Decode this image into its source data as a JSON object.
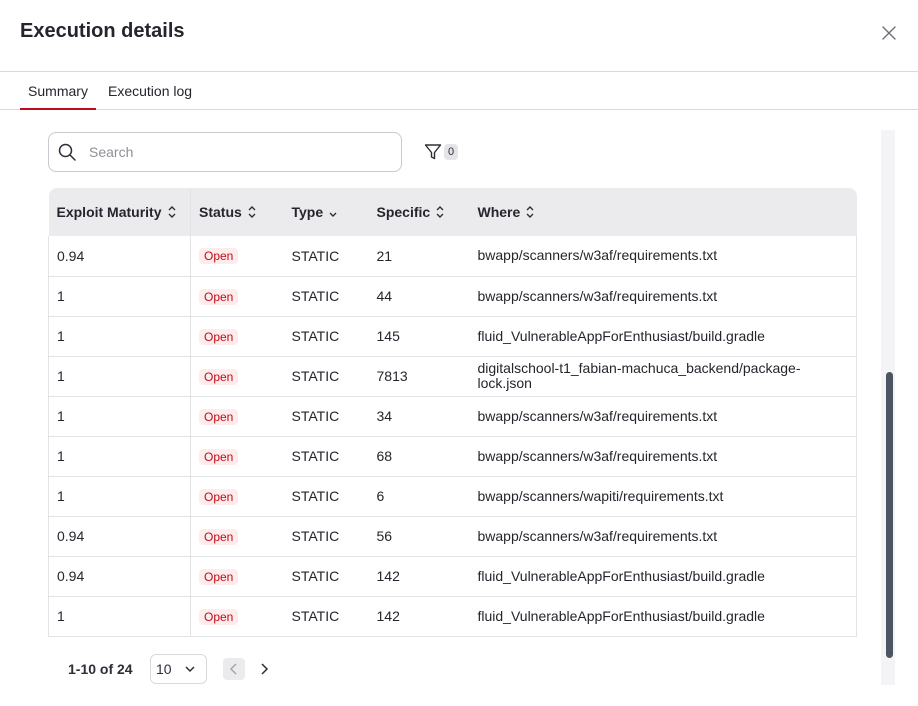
{
  "dialog": {
    "title": "Execution details"
  },
  "tabs": [
    {
      "label": "Summary",
      "active": true
    },
    {
      "label": "Execution log",
      "active": false
    }
  ],
  "search": {
    "placeholder": "Search",
    "value": ""
  },
  "filter": {
    "count": "0",
    "icon": "filter-icon"
  },
  "table": {
    "columns": [
      "Exploit Maturity",
      "Status",
      "Type",
      "Specific",
      "Where"
    ],
    "rows": [
      {
        "exploit_maturity": "0.94",
        "status": "Open",
        "type": "STATIC",
        "specific": "21",
        "where": "bwapp/scanners/w3af/requirements.txt"
      },
      {
        "exploit_maturity": "1",
        "status": "Open",
        "type": "STATIC",
        "specific": "44",
        "where": "bwapp/scanners/w3af/requirements.txt"
      },
      {
        "exploit_maturity": "1",
        "status": "Open",
        "type": "STATIC",
        "specific": "145",
        "where": "fluid_VulnerableAppForEnthusiast/build.gradle"
      },
      {
        "exploit_maturity": "1",
        "status": "Open",
        "type": "STATIC",
        "specific": "7813",
        "where": "digitalschool-t1_fabian-machuca_backend/package-lock.json"
      },
      {
        "exploit_maturity": "1",
        "status": "Open",
        "type": "STATIC",
        "specific": "34",
        "where": "bwapp/scanners/w3af/requirements.txt"
      },
      {
        "exploit_maturity": "1",
        "status": "Open",
        "type": "STATIC",
        "specific": "68",
        "where": "bwapp/scanners/w3af/requirements.txt"
      },
      {
        "exploit_maturity": "1",
        "status": "Open",
        "type": "STATIC",
        "specific": "6",
        "where": "bwapp/scanners/wapiti/requirements.txt"
      },
      {
        "exploit_maturity": "0.94",
        "status": "Open",
        "type": "STATIC",
        "specific": "56",
        "where": "bwapp/scanners/w3af/requirements.txt"
      },
      {
        "exploit_maturity": "0.94",
        "status": "Open",
        "type": "STATIC",
        "specific": "142",
        "where": "fluid_VulnerableAppForEnthusiast/build.gradle"
      },
      {
        "exploit_maturity": "1",
        "status": "Open",
        "type": "STATIC",
        "specific": "142",
        "where": "fluid_VulnerableAppForEnthusiast/build.gradle"
      }
    ]
  },
  "pagination": {
    "range": "1-10 of 24",
    "page_size": "10"
  },
  "colors": {
    "accent": "#bf0b1a",
    "badge_bg": "#fdeceb",
    "header_bg": "#ebebee",
    "scroll_thumb": "#4d5562"
  }
}
